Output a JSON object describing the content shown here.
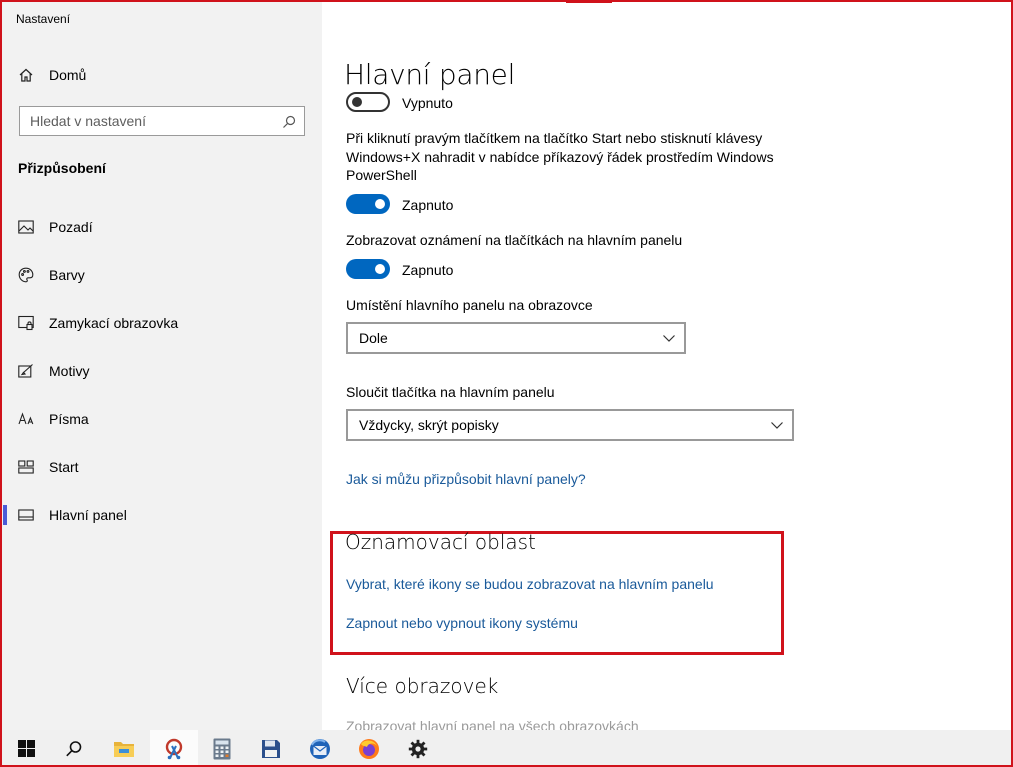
{
  "window": {
    "title": "Nastavení"
  },
  "sidebar": {
    "home_label": "Domů",
    "search_placeholder": "Hledat v nastavení",
    "section_title": "Přizpůsobení",
    "items": [
      {
        "label": "Pozadí",
        "icon": "picture-icon"
      },
      {
        "label": "Barvy",
        "icon": "palette-icon"
      },
      {
        "label": "Zamykací obrazovka",
        "icon": "lock-screen-icon"
      },
      {
        "label": "Motivy",
        "icon": "themes-icon"
      },
      {
        "label": "Písma",
        "icon": "fonts-icon"
      },
      {
        "label": "Start",
        "icon": "start-icon"
      },
      {
        "label": "Hlavní panel",
        "icon": "taskbar-icon",
        "active": true
      }
    ]
  },
  "main": {
    "title": "Hlavní panel",
    "toggle1": {
      "label": "Vypnuto",
      "on": false
    },
    "setting2": {
      "line1": "Při kliknutí pravým tlačítkem na tlačítko Start nebo stisknutí klávesy",
      "line2": "Windows+X nahradit v nabídce příkazový řádek prostředím Windows",
      "line3": "PowerShell",
      "state": "Zapnuto",
      "on": true
    },
    "setting3": {
      "label": "Zobrazovat oznámení na tlačítkách na hlavním panelu",
      "state": "Zapnuto",
      "on": true
    },
    "position": {
      "label": "Umístění hlavního panelu na obrazovce",
      "value": "Dole"
    },
    "combine": {
      "label": "Sloučit tlačítka na hlavním panelu",
      "value": "Vždycky, skrýt popisky"
    },
    "help_link": "Jak si můžu přizpůsobit hlavní panely?",
    "notification_area": {
      "title": "Oznamovací oblast",
      "link1": "Vybrat, které ikony se budou zobrazovat na hlavním panelu",
      "link2": "Zapnout nebo vypnout ikony systému"
    },
    "multiple_displays": {
      "title": "Více obrazovek",
      "partial_text": "Zobrazovat hlavní panel na všech obrazovkách"
    }
  },
  "taskbar": {
    "items": [
      "windows-start-icon",
      "search-icon",
      "file-explorer-icon",
      "snipping-tool-icon",
      "calculator-icon",
      "save-icon",
      "thunderbird-icon",
      "firefox-icon",
      "settings-gear-icon"
    ]
  },
  "colors": {
    "accent": "#0067c0",
    "link": "#1a5a9a",
    "highlight_frame": "#d0121b",
    "active_indicator": "#4b5bd6"
  }
}
